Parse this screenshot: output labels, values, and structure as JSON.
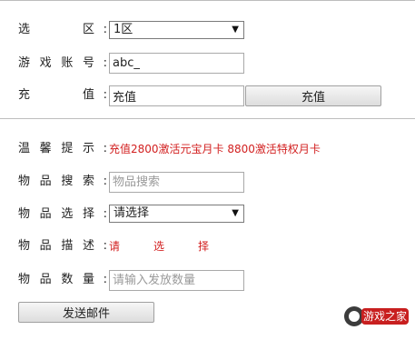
{
  "form": {
    "zone": {
      "label": "选区",
      "value": "1区"
    },
    "account": {
      "label": "游戏账号",
      "value": "abc_"
    },
    "recharge": {
      "label": "充值",
      "value": "充值",
      "button_label": "充值"
    },
    "tip": {
      "label": "温馨提示",
      "text": "充值2800激活元宝月卡 8800激活特权月卡"
    },
    "item_search": {
      "label": "物品搜索",
      "placeholder": "物品搜索"
    },
    "item_select": {
      "label": "物品选择",
      "value": "请选择"
    },
    "item_desc": {
      "label": "物品描述",
      "text_chars": [
        "请",
        "选",
        "择"
      ]
    },
    "item_qty": {
      "label": "物品数量",
      "placeholder": "请输入发放数量"
    },
    "send_button_label": "发送邮件",
    "colon": ":"
  },
  "watermark": {
    "text": "游戏之家"
  },
  "colors": {
    "accent_red": "#d21f1f",
    "border": "#a9a9a9",
    "button_gradient_top": "#f6f6f6",
    "button_gradient_bottom": "#dddddd"
  },
  "icons": {
    "dropdown": "chevron-down-icon"
  }
}
